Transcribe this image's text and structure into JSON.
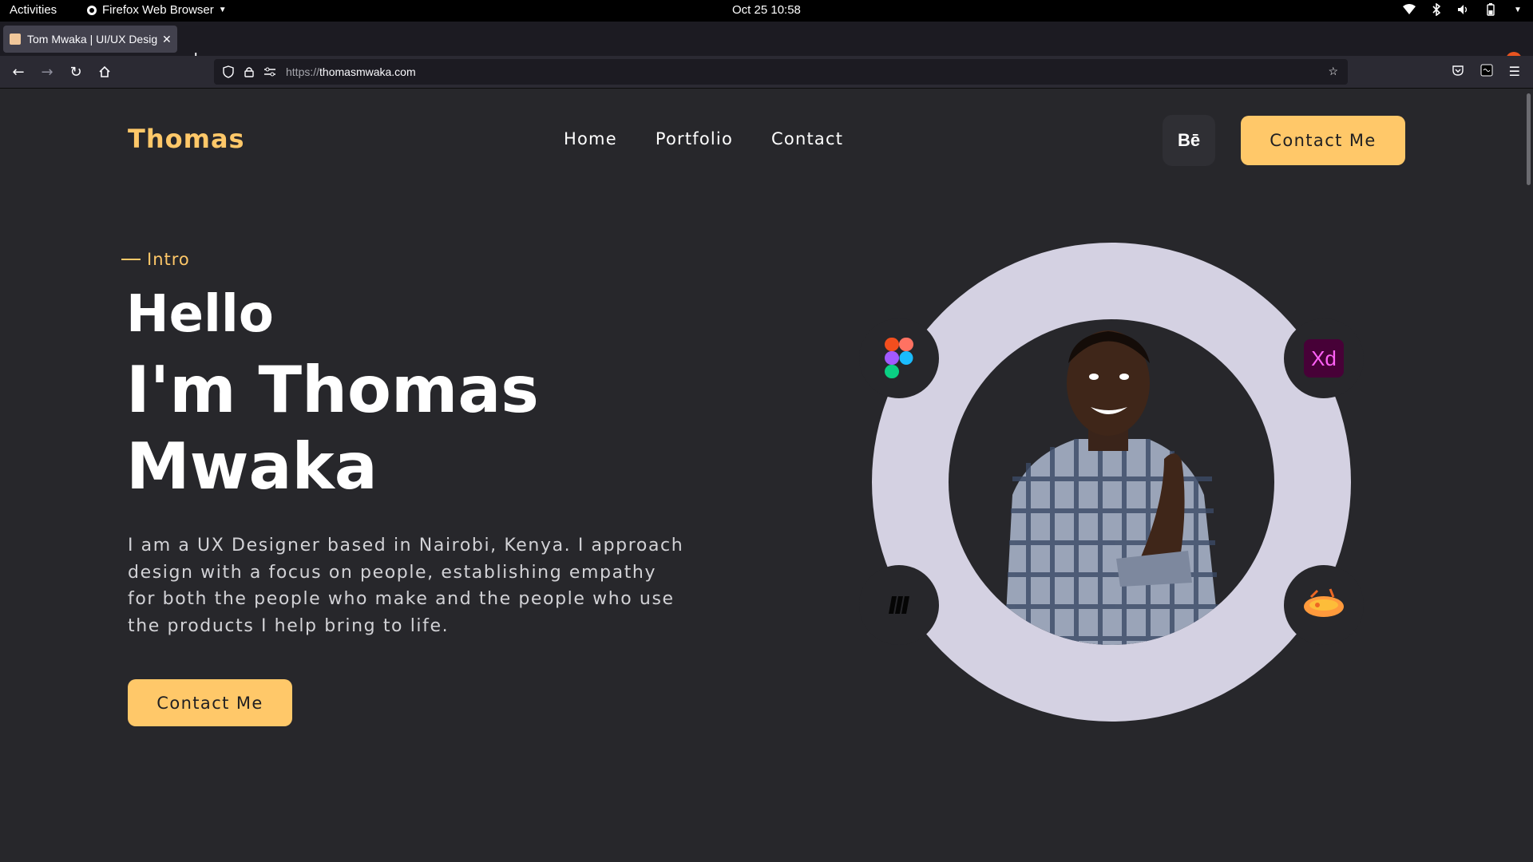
{
  "system_bar": {
    "activities": "Activities",
    "app_name": "Firefox Web Browser",
    "clock": "Oct 25  10:58"
  },
  "browser": {
    "tab_title": "Tom Mwaka | UI/UX Desig",
    "url_protocol": "https://",
    "url_host": "thomasmwaka.com"
  },
  "site": {
    "logo": "Thomas",
    "nav": [
      "Home",
      "Portfolio",
      "Contact"
    ],
    "behance_label": "Bē",
    "header_cta": "Contact Me",
    "intro_label": "Intro",
    "hello": "Hello",
    "name_line1": "I'm Thomas",
    "name_line2": "Mwaka",
    "bio": "I am a UX Designer based in Nairobi, Kenya. I approach design with a focus on people, establishing empathy for both the people who make and the people who use the products I help bring to life.",
    "main_cta": "Contact Me",
    "tools": [
      "figma-icon",
      "adobe-xd-icon",
      "miro-icon",
      "zeplin-icon"
    ],
    "xd_label": "Xd"
  },
  "colors": {
    "background": "#27272b",
    "accent": "#ffc869",
    "ring": "#d4d1e2",
    "text": "#ffffff"
  }
}
